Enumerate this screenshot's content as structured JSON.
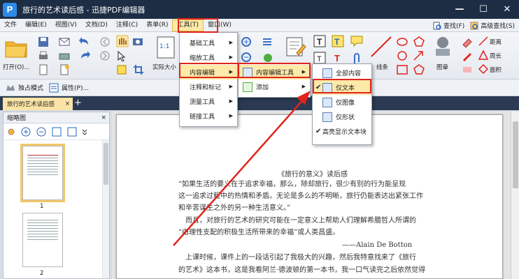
{
  "window": {
    "title": "旅行的艺术读后感 - 迅捷PDF编辑器",
    "logo_letter": "P",
    "minimize": "—",
    "maximize": "☐",
    "close": "✕"
  },
  "menubar": {
    "items": [
      "文件",
      "编辑(E)",
      "视图(V)",
      "文档(D)",
      "注释(C)",
      "表单(R)",
      "工具(T)",
      "窗口(W)"
    ],
    "right": [
      "查找(F)",
      "高级查找(S)"
    ]
  },
  "ribbon": {
    "open_label": "打开(O)...",
    "fit_label": "实际大小",
    "link_label": "线条",
    "stamp_label": "图章",
    "distance": "距离",
    "perimeter": "周长",
    "area": "面积",
    "zoom_badge": "1:1",
    "mode_label": "独占模式",
    "props_label": "属性(P)..."
  },
  "tab": {
    "name": "旅行的艺术读后感",
    "close": "×",
    "add": "+"
  },
  "thumbs": {
    "title": "缩略图",
    "close": "×",
    "pages": [
      "1",
      "2"
    ]
  },
  "tools_menu": {
    "items": [
      {
        "label": "基础工具"
      },
      {
        "label": "缩放工具"
      },
      {
        "label": "内容编辑"
      },
      {
        "label": "注释和标记"
      },
      {
        "label": "测量工具"
      },
      {
        "label": "链接工具"
      }
    ]
  },
  "content_menu": {
    "items": [
      "内容编辑工具",
      "添加"
    ]
  },
  "edit_menu": {
    "items": [
      "全部内容",
      "仅文本",
      "仅图像",
      "仅形状",
      "高亮显示文本块"
    ]
  },
  "document": {
    "title": "《旅行的意义》读后感",
    "lines": [
      "“如果生活的要义在于追求幸福，那么，除却旅行，很少有别的行为能呈现",
      "这一追求过程中的热情和矛盾。无论是多么的不明晰，旅行仍能表达出紧张工作",
      "和辛苦谋生之外的另一种生活意义。”",
      "　而且，对旅行的艺术的研究可能在一定意义上帮助人们理解希腊哲人所谓的",
      "“由理性支配的积极生活所带来的幸福”或人类昌盛。",
      "——Alain De Botton",
      "　上课时候，课件上的一段话引起了我极大的兴趣，然后我特意找来了《旅行",
      "的艺术》这本书，这是我看阿兰·德波顿的第一本书，我一口气读完之后依然觉得"
    ]
  },
  "colors": {
    "titlebar": "#1d2d44",
    "highlight": "#fde9a8",
    "annotation": "#e0241c"
  }
}
